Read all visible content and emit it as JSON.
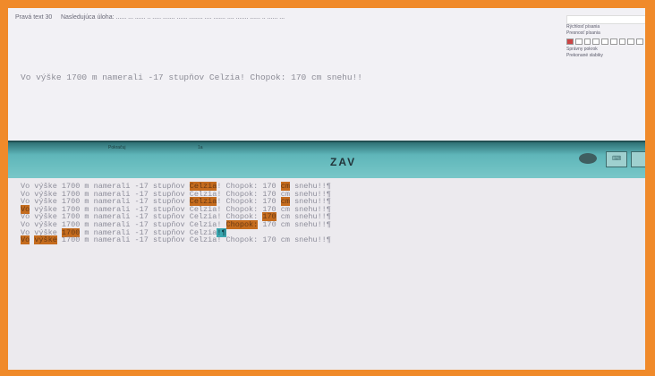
{
  "instruction": "Nasledujúca úloha: ...... ... ...... .. ..... ....... ...... ........ .... ....... .... ....... ...... .. ...... ...",
  "instruction_sub": "Pravá text 30",
  "side_panel": {
    "label1": "Rýchlosť písania",
    "label2": "Presnosť písania",
    "label3": "Správny pokrok",
    "label4": "Prekonané slabiky"
  },
  "top_sentence": "Vo výške 1700 m namerali -17 stupňov Celzia! Chopok: 170 cm snehu!!",
  "header": {
    "label_left": "Pokračuj",
    "label_mid": "1a",
    "title": "ZAV",
    "icon_a": "eye-icon",
    "icon_b": "keyboard-icon",
    "icon_c": "exit-icon"
  },
  "typed_lines": [
    [
      {
        "t": "Vo výške 1700 m namerali -17 stupňov "
      },
      {
        "t": "Celzia",
        "hl": 1
      },
      {
        "t": "! Chopok: 170 "
      },
      {
        "t": "cm",
        "hl": 1
      },
      {
        "t": " snehu!!¶"
      }
    ],
    [
      {
        "t": "Vo výške 1700 m namerali -17 stupňov Celzia! Chopok: 170 cm snehu!!¶"
      }
    ],
    [
      {
        "t": "Vo výške 1700 m namerali -17 stupňov "
      },
      {
        "t": "Celzia",
        "hl": 1
      },
      {
        "t": "! Chopok: 170 "
      },
      {
        "t": "cm",
        "hl": 1
      },
      {
        "t": " snehu!!¶"
      }
    ],
    [
      {
        "t": "Vo",
        "hl": 1
      },
      {
        "t": " výške 1700 m namerali -17 stupňov Celzia! Chopok: 170 cm snehu!!¶"
      }
    ],
    [
      {
        "t": "Vo výške 1700 m namerali -17 stupňov Celzia! Chopok: "
      },
      {
        "t": "170",
        "hl": 1
      },
      {
        "t": " cm snehu!!¶"
      }
    ],
    [
      {
        "t": "Vo výške 1700 m namerali -17 stupňov Celzia! "
      },
      {
        "t": "Chopok:",
        "hl": 1
      },
      {
        "t": " 170 cm snehu!!¶"
      }
    ],
    [
      {
        "t": "Vo výške "
      },
      {
        "t": "1700",
        "hl": 1
      },
      {
        "t": " m namerali -17 stupňov Celzia"
      },
      {
        "t": "!¶",
        "cur": 1
      }
    ],
    [
      {
        "t": "Vo",
        "hl": 1
      },
      {
        "t": " "
      },
      {
        "t": "výške",
        "hl": 1
      },
      {
        "t": " 1700 m namerali -17 stupňov Celzia! Chopok: 170 cm snehu!!¶"
      }
    ]
  ]
}
